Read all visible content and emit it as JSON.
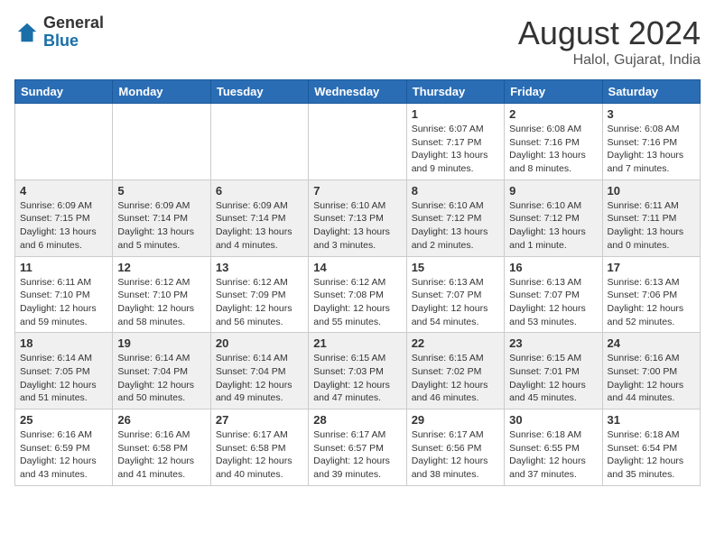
{
  "header": {
    "logo_general": "General",
    "logo_blue": "Blue",
    "month_title": "August 2024",
    "location": "Halol, Gujarat, India"
  },
  "days_of_week": [
    "Sunday",
    "Monday",
    "Tuesday",
    "Wednesday",
    "Thursday",
    "Friday",
    "Saturday"
  ],
  "weeks": [
    [
      {
        "day": "",
        "info": ""
      },
      {
        "day": "",
        "info": ""
      },
      {
        "day": "",
        "info": ""
      },
      {
        "day": "",
        "info": ""
      },
      {
        "day": "1",
        "info": "Sunrise: 6:07 AM\nSunset: 7:17 PM\nDaylight: 13 hours\nand 9 minutes."
      },
      {
        "day": "2",
        "info": "Sunrise: 6:08 AM\nSunset: 7:16 PM\nDaylight: 13 hours\nand 8 minutes."
      },
      {
        "day": "3",
        "info": "Sunrise: 6:08 AM\nSunset: 7:16 PM\nDaylight: 13 hours\nand 7 minutes."
      }
    ],
    [
      {
        "day": "4",
        "info": "Sunrise: 6:09 AM\nSunset: 7:15 PM\nDaylight: 13 hours\nand 6 minutes."
      },
      {
        "day": "5",
        "info": "Sunrise: 6:09 AM\nSunset: 7:14 PM\nDaylight: 13 hours\nand 5 minutes."
      },
      {
        "day": "6",
        "info": "Sunrise: 6:09 AM\nSunset: 7:14 PM\nDaylight: 13 hours\nand 4 minutes."
      },
      {
        "day": "7",
        "info": "Sunrise: 6:10 AM\nSunset: 7:13 PM\nDaylight: 13 hours\nand 3 minutes."
      },
      {
        "day": "8",
        "info": "Sunrise: 6:10 AM\nSunset: 7:12 PM\nDaylight: 13 hours\nand 2 minutes."
      },
      {
        "day": "9",
        "info": "Sunrise: 6:10 AM\nSunset: 7:12 PM\nDaylight: 13 hours\nand 1 minute."
      },
      {
        "day": "10",
        "info": "Sunrise: 6:11 AM\nSunset: 7:11 PM\nDaylight: 13 hours\nand 0 minutes."
      }
    ],
    [
      {
        "day": "11",
        "info": "Sunrise: 6:11 AM\nSunset: 7:10 PM\nDaylight: 12 hours\nand 59 minutes."
      },
      {
        "day": "12",
        "info": "Sunrise: 6:12 AM\nSunset: 7:10 PM\nDaylight: 12 hours\nand 58 minutes."
      },
      {
        "day": "13",
        "info": "Sunrise: 6:12 AM\nSunset: 7:09 PM\nDaylight: 12 hours\nand 56 minutes."
      },
      {
        "day": "14",
        "info": "Sunrise: 6:12 AM\nSunset: 7:08 PM\nDaylight: 12 hours\nand 55 minutes."
      },
      {
        "day": "15",
        "info": "Sunrise: 6:13 AM\nSunset: 7:07 PM\nDaylight: 12 hours\nand 54 minutes."
      },
      {
        "day": "16",
        "info": "Sunrise: 6:13 AM\nSunset: 7:07 PM\nDaylight: 12 hours\nand 53 minutes."
      },
      {
        "day": "17",
        "info": "Sunrise: 6:13 AM\nSunset: 7:06 PM\nDaylight: 12 hours\nand 52 minutes."
      }
    ],
    [
      {
        "day": "18",
        "info": "Sunrise: 6:14 AM\nSunset: 7:05 PM\nDaylight: 12 hours\nand 51 minutes."
      },
      {
        "day": "19",
        "info": "Sunrise: 6:14 AM\nSunset: 7:04 PM\nDaylight: 12 hours\nand 50 minutes."
      },
      {
        "day": "20",
        "info": "Sunrise: 6:14 AM\nSunset: 7:04 PM\nDaylight: 12 hours\nand 49 minutes."
      },
      {
        "day": "21",
        "info": "Sunrise: 6:15 AM\nSunset: 7:03 PM\nDaylight: 12 hours\nand 47 minutes."
      },
      {
        "day": "22",
        "info": "Sunrise: 6:15 AM\nSunset: 7:02 PM\nDaylight: 12 hours\nand 46 minutes."
      },
      {
        "day": "23",
        "info": "Sunrise: 6:15 AM\nSunset: 7:01 PM\nDaylight: 12 hours\nand 45 minutes."
      },
      {
        "day": "24",
        "info": "Sunrise: 6:16 AM\nSunset: 7:00 PM\nDaylight: 12 hours\nand 44 minutes."
      }
    ],
    [
      {
        "day": "25",
        "info": "Sunrise: 6:16 AM\nSunset: 6:59 PM\nDaylight: 12 hours\nand 43 minutes."
      },
      {
        "day": "26",
        "info": "Sunrise: 6:16 AM\nSunset: 6:58 PM\nDaylight: 12 hours\nand 41 minutes."
      },
      {
        "day": "27",
        "info": "Sunrise: 6:17 AM\nSunset: 6:58 PM\nDaylight: 12 hours\nand 40 minutes."
      },
      {
        "day": "28",
        "info": "Sunrise: 6:17 AM\nSunset: 6:57 PM\nDaylight: 12 hours\nand 39 minutes."
      },
      {
        "day": "29",
        "info": "Sunrise: 6:17 AM\nSunset: 6:56 PM\nDaylight: 12 hours\nand 38 minutes."
      },
      {
        "day": "30",
        "info": "Sunrise: 6:18 AM\nSunset: 6:55 PM\nDaylight: 12 hours\nand 37 minutes."
      },
      {
        "day": "31",
        "info": "Sunrise: 6:18 AM\nSunset: 6:54 PM\nDaylight: 12 hours\nand 35 minutes."
      }
    ]
  ]
}
